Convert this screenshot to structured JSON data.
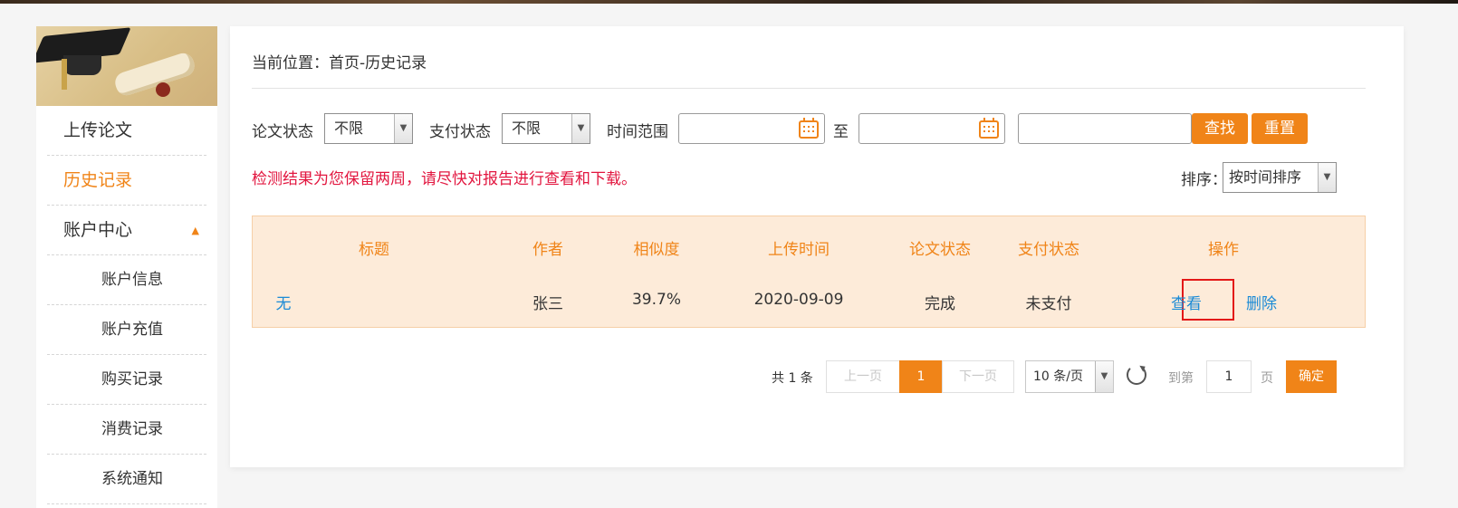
{
  "sidebar": {
    "items": [
      {
        "label": "上传论文"
      },
      {
        "label": "历史记录"
      },
      {
        "label": "账户中心",
        "arrow": "▲"
      },
      {
        "label": "账户信息"
      },
      {
        "label": "账户充值"
      },
      {
        "label": "购买记录"
      },
      {
        "label": "消费记录"
      },
      {
        "label": "系统通知"
      }
    ]
  },
  "breadcrumb": "当前位置：首页-历史记录",
  "filters": {
    "paper_status_label": "论文状态",
    "paper_status_value": "不限",
    "pay_status_label": "支付状态",
    "pay_status_value": "不限",
    "time_range_label": "时间范围",
    "to_label": "至",
    "search_label": "查找",
    "reset_label": "重置"
  },
  "notice": "检测结果为您保留两周，请尽快对报告进行查看和下载。",
  "sort": {
    "label": "排序：",
    "value": "按时间排序"
  },
  "table": {
    "headers": [
      "标题",
      "作者",
      "相似度",
      "上传时间",
      "论文状态",
      "支付状态",
      "操作"
    ],
    "rows": [
      {
        "title": "无",
        "author": "张三",
        "similarity": "39.7%",
        "upload_time": "2020-09-09",
        "paper_status": "完成",
        "pay_status": "未支付",
        "view": "查看",
        "delete": "删除"
      }
    ]
  },
  "pager": {
    "total": "共 1 条",
    "prev": "上一页",
    "current": "1",
    "next": "下一页",
    "page_size": "10 条/页",
    "goto_label": "到第",
    "goto_value": "1",
    "page_unit": "页",
    "confirm": "确定"
  },
  "colors": {
    "accent": "#f08418",
    "link": "#1a8ad6",
    "notice": "#e2163f",
    "table_bg": "#fdebd9"
  },
  "icons": [
    "calendar-icon",
    "refresh-icon",
    "chevron-down-icon",
    "graduation-cap-icon"
  ]
}
